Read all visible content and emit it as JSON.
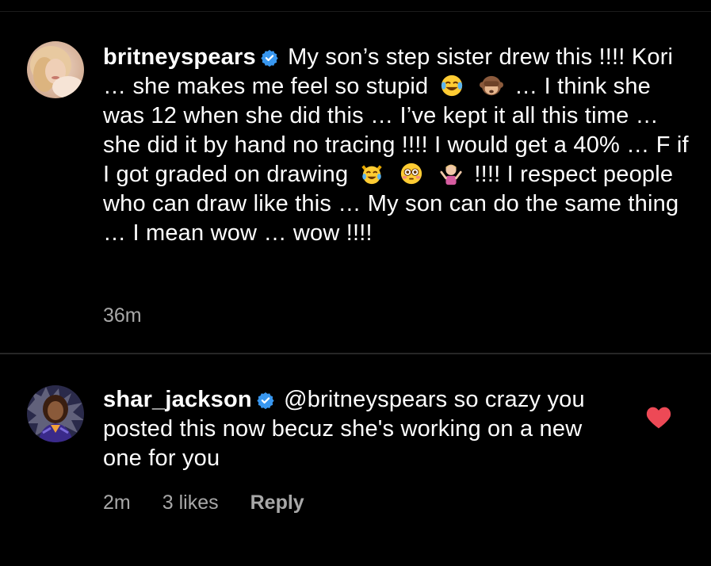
{
  "comments": [
    {
      "username": "britneyspears",
      "verified": true,
      "text_segments": [
        "My son’s step sister drew this !!!! Kori … she makes me feel so stupid",
        "… I think she was 12 when she did this … I’ve kept it all this time … she did it by hand no tracing !!!! I would get a 40% … F if I got graded on drawing",
        "!!!! I respect people who can draw like this … My son can do the same thing … I mean wow … wow !!!!"
      ],
      "emojis": [
        "face-with-tears-of-joy-emoji",
        "see-no-evil-monkey-emoji",
        "crying-cat-emoji",
        "flushed-face-emoji",
        "person-shrugging-emoji"
      ],
      "time": "36m"
    },
    {
      "username": "shar_jackson",
      "verified": true,
      "text": "@britneyspears so crazy you posted this now becuz she's working on a new one for you",
      "time": "2m",
      "likes": "3 likes",
      "reply_label": "Reply",
      "liked": true
    }
  ],
  "colors": {
    "background": "#000000",
    "text": "#ffffff",
    "meta": "#a8a8a8",
    "verified": "#3897f0",
    "heart": "#ed4956"
  }
}
